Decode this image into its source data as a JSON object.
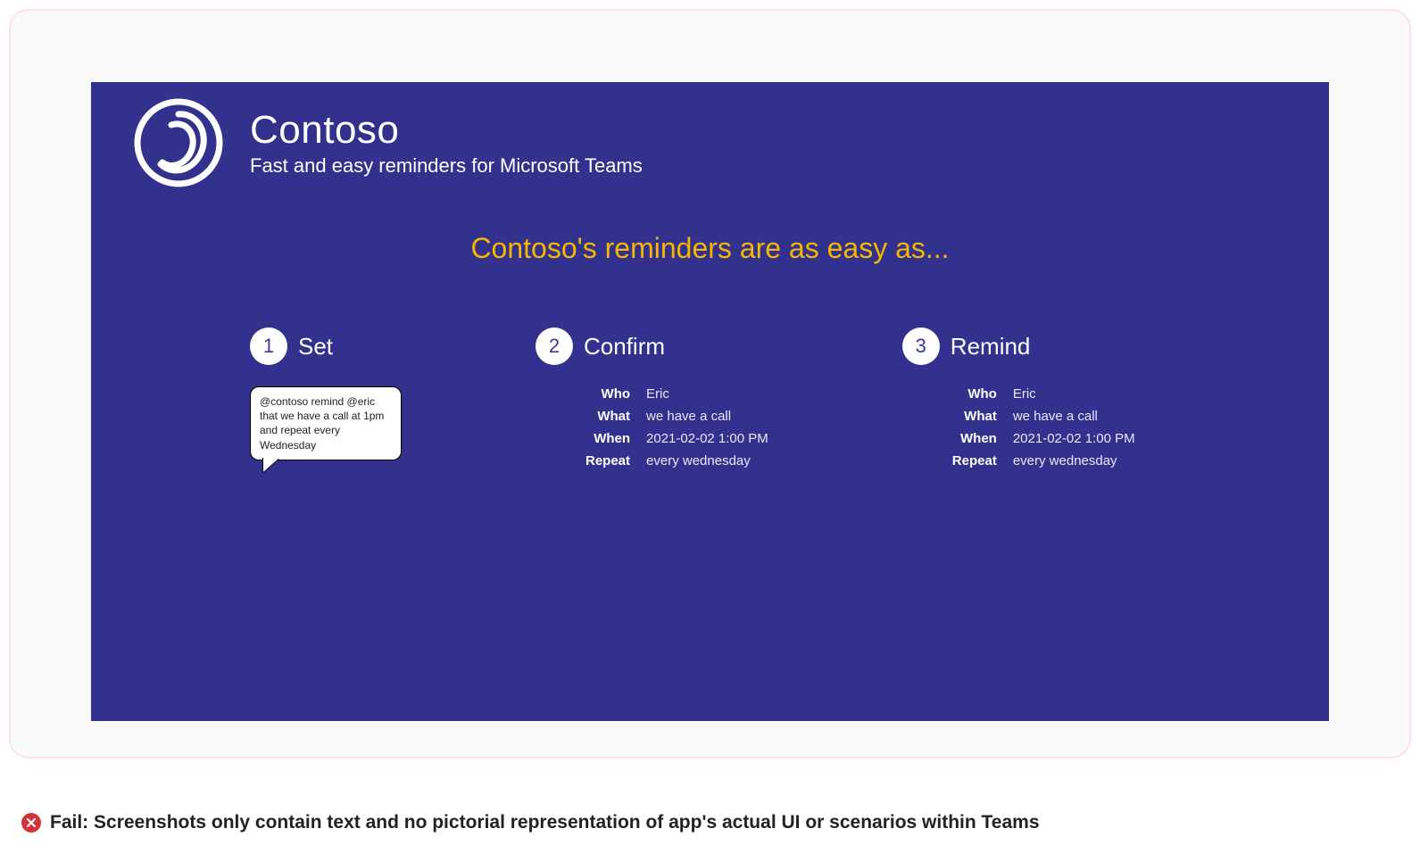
{
  "brand": {
    "name": "Contoso",
    "subtitle": "Fast and easy reminders for Microsoft Teams"
  },
  "tagline": "Contoso's reminders are as easy as...",
  "steps": [
    {
      "num": "1",
      "title": "Set",
      "bubble": "@contoso remind @eric that we have a call at 1pm and repeat every Wednesday"
    },
    {
      "num": "2",
      "title": "Confirm",
      "fields": {
        "who_label": "Who",
        "who": "Eric",
        "what_label": "What",
        "what": "we have a call",
        "when_label": "When",
        "when": "2021-02-02 1:00 PM",
        "repeat_label": "Repeat",
        "repeat": "every wednesday"
      }
    },
    {
      "num": "3",
      "title": "Remind",
      "fields": {
        "who_label": "Who",
        "who": "Eric",
        "what_label": "What",
        "what": "we have a call",
        "when_label": "When",
        "when": "2021-02-02 1:00 PM",
        "repeat_label": "Repeat",
        "repeat": "every wednesday"
      }
    }
  ],
  "caption": "Fail: Screenshots only contain text and no pictorial representation of app's actual UI or scenarios within Teams"
}
